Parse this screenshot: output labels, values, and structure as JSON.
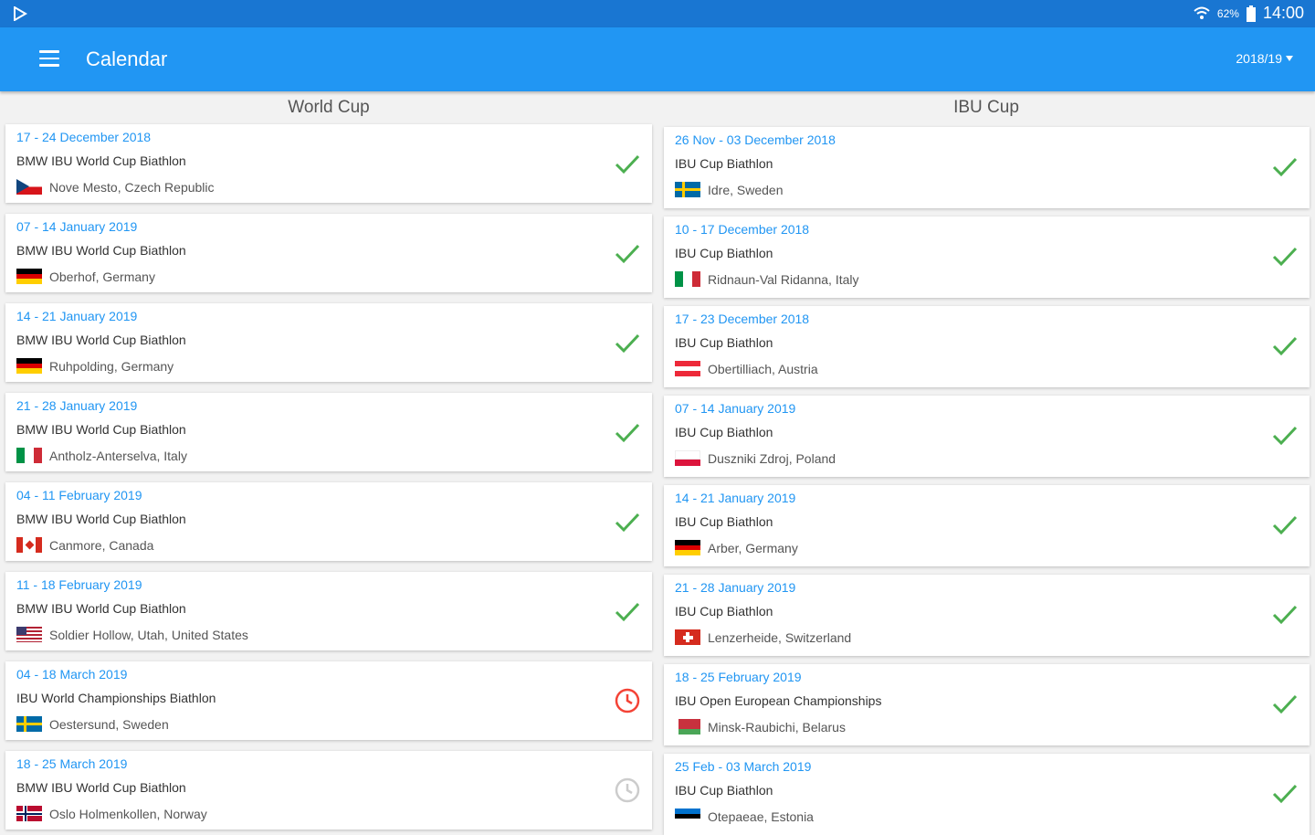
{
  "status_bar": {
    "time": "14:00",
    "battery_percent": "62%"
  },
  "toolbar": {
    "title": "Calendar",
    "season": "2018/19"
  },
  "colors": {
    "accent": "#2196f3",
    "check": "#4caf50",
    "pending": "#f44336",
    "future": "#cccccc"
  },
  "columns": [
    {
      "header": "World Cup",
      "events": [
        {
          "date": "17 - 24 December 2018",
          "name": "BMW IBU World Cup Biathlon",
          "location": "Nove Mesto, Czech Republic",
          "flag": "cz",
          "status": "done"
        },
        {
          "date": "07 - 14 January 2019",
          "name": "BMW IBU World Cup Biathlon",
          "location": "Oberhof, Germany",
          "flag": "de",
          "status": "done"
        },
        {
          "date": "14 - 21 January 2019",
          "name": "BMW IBU World Cup Biathlon",
          "location": "Ruhpolding, Germany",
          "flag": "de",
          "status": "done"
        },
        {
          "date": "21 - 28 January 2019",
          "name": "BMW IBU World Cup Biathlon",
          "location": "Antholz-Anterselva, Italy",
          "flag": "it",
          "status": "done"
        },
        {
          "date": "04 - 11 February 2019",
          "name": "BMW IBU World Cup Biathlon",
          "location": "Canmore, Canada",
          "flag": "ca",
          "status": "done"
        },
        {
          "date": "11 - 18 February 2019",
          "name": "BMW IBU World Cup Biathlon",
          "location": "Soldier Hollow, Utah, United States",
          "flag": "us",
          "status": "done"
        },
        {
          "date": "04 - 18 March 2019",
          "name": "IBU World Championships Biathlon",
          "location": "Oestersund, Sweden",
          "flag": "se",
          "status": "current"
        },
        {
          "date": "18 - 25 March 2019",
          "name": "BMW IBU World Cup Biathlon",
          "location": "Oslo Holmenkollen, Norway",
          "flag": "no",
          "status": "upcoming"
        }
      ]
    },
    {
      "header": "IBU Cup",
      "events": [
        {
          "date": "26 Nov - 03 December 2018",
          "name": "IBU Cup Biathlon",
          "location": "Idre, Sweden",
          "flag": "se",
          "status": "done"
        },
        {
          "date": "10 - 17 December 2018",
          "name": "IBU Cup Biathlon",
          "location": "Ridnaun-Val Ridanna, Italy",
          "flag": "it",
          "status": "done"
        },
        {
          "date": "17 - 23 December 2018",
          "name": "IBU Cup Biathlon",
          "location": "Obertilliach, Austria",
          "flag": "at",
          "status": "done"
        },
        {
          "date": "07 - 14 January 2019",
          "name": "IBU Cup Biathlon",
          "location": "Duszniki Zdroj, Poland",
          "flag": "pl",
          "status": "done"
        },
        {
          "date": "14 - 21 January 2019",
          "name": "IBU Cup Biathlon",
          "location": "Arber, Germany",
          "flag": "de",
          "status": "done"
        },
        {
          "date": "21 - 28 January 2019",
          "name": "IBU Cup Biathlon",
          "location": "Lenzerheide, Switzerland",
          "flag": "ch",
          "status": "done"
        },
        {
          "date": "18 - 25 February 2019",
          "name": "IBU Open European Championships",
          "location": "Minsk-Raubichi, Belarus",
          "flag": "by",
          "status": "done"
        },
        {
          "date": "25 Feb - 03 March 2019",
          "name": "IBU Cup Biathlon",
          "location": "Otepaeae, Estonia",
          "flag": "ee",
          "status": "done"
        }
      ]
    }
  ]
}
